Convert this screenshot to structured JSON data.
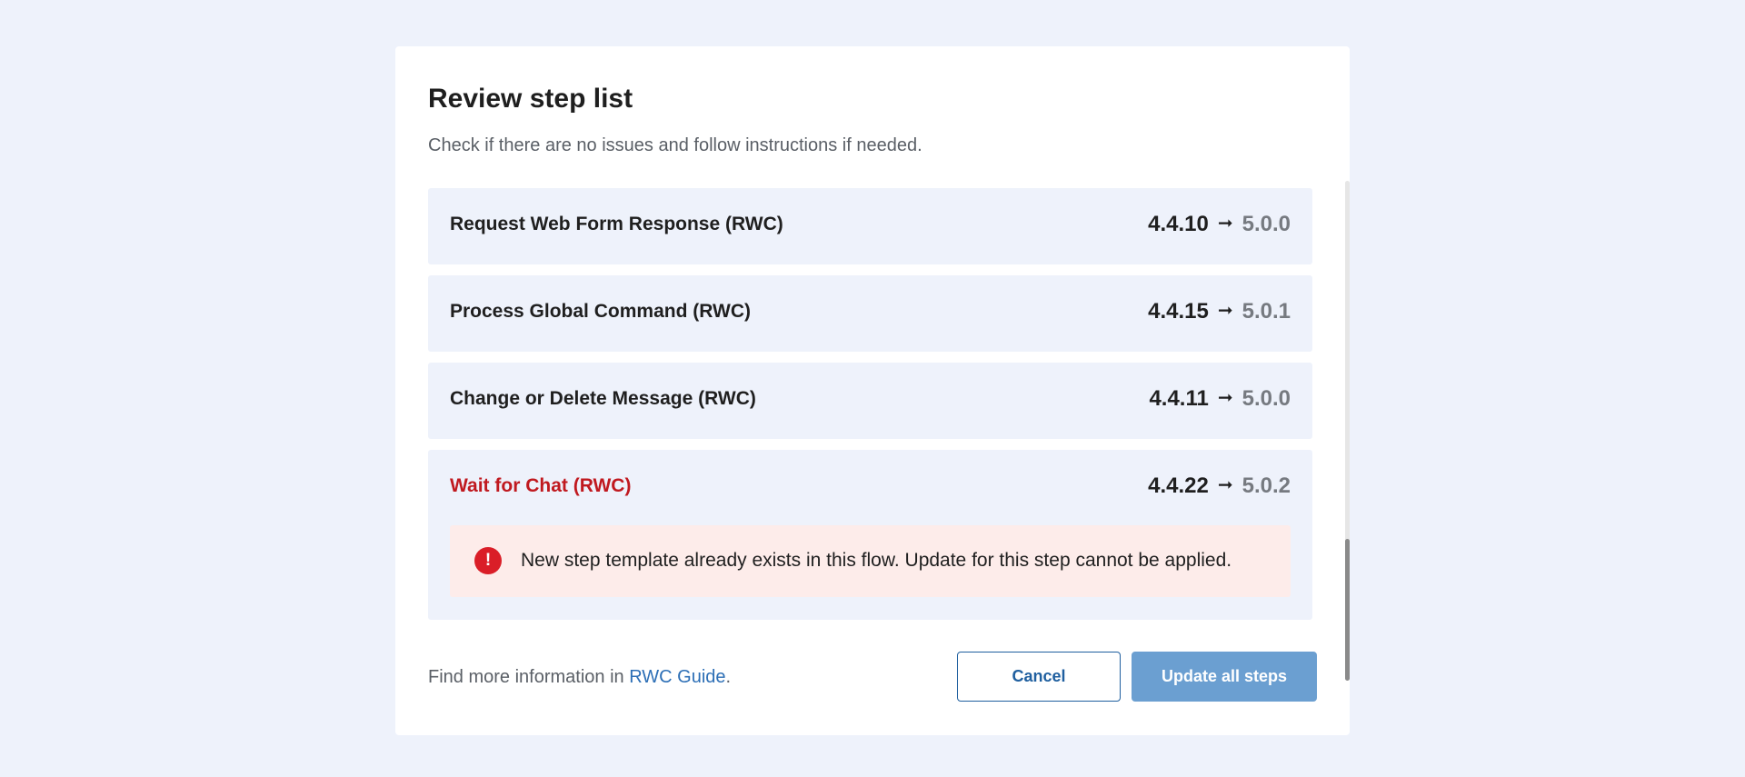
{
  "dialog": {
    "title": "Review step list",
    "subtitle": "Check if there are no issues and follow instructions if needed."
  },
  "steps": [
    {
      "name": "Request Web Form Response (RWC)",
      "from_version": "4.4.10",
      "to_version": "5.0.0",
      "status": "ok"
    },
    {
      "name": "Process Global Command (RWC)",
      "from_version": "4.4.15",
      "to_version": "5.0.1",
      "status": "ok"
    },
    {
      "name": "Change or Delete Message (RWC)",
      "from_version": "4.4.11",
      "to_version": "5.0.0",
      "status": "ok"
    },
    {
      "name": "Wait for Chat (RWC)",
      "from_version": "4.4.22",
      "to_version": "5.0.2",
      "status": "error",
      "message": "New step template already exists in this flow. Update for this step cannot be applied."
    }
  ],
  "arrow_symbol": "➞",
  "warning_icon_symbol": "!",
  "footer": {
    "info_prefix": "Find more information in ",
    "link_text": "RWC Guide",
    "info_suffix": "."
  },
  "buttons": {
    "cancel_label": "Cancel",
    "update_label": "Update all steps"
  },
  "colors": {
    "page_background": "#eef2fb",
    "row_background": "#eef2fb",
    "error_text": "#c0191f",
    "error_background": "#fdecea",
    "error_icon": "#da1e28",
    "link": "#2d6fb6",
    "primary_button": "#6b9fd1",
    "secondary_button_border": "#1f5f9f"
  },
  "icons": {
    "warning": "error-circle-icon",
    "arrow": "arrow-right-icon"
  }
}
